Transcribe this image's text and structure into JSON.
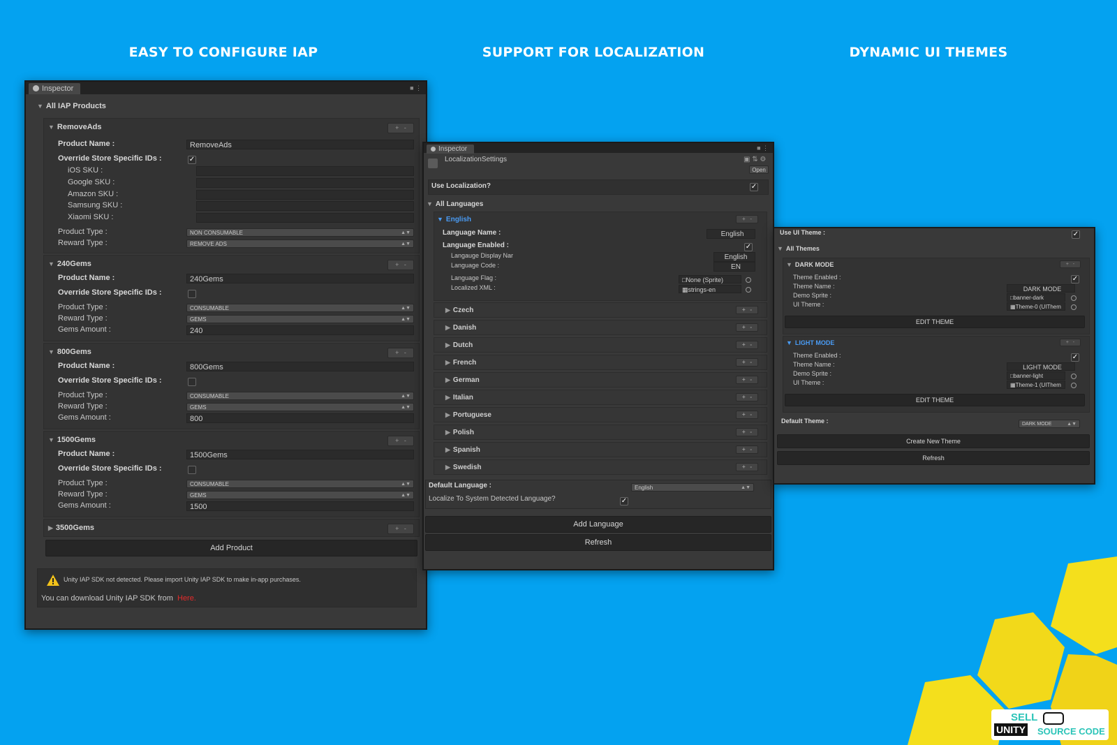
{
  "headings": {
    "iap": "EASY TO CONFIGURE IAP",
    "localization": "SUPPORT FOR LOCALIZATION",
    "themes": "DYNAMIC UI THEMES"
  },
  "iap_panel": {
    "tab": "Inspector",
    "root_label": "All IAP Products",
    "labels": {
      "product_name": "Product Name :",
      "override": "Override Store Specific IDs :",
      "ios": "iOS SKU :",
      "google": "Google SKU :",
      "amazon": "Amazon SKU :",
      "samsung": "Samsung SKU :",
      "xiaomi": "Xiaomi SKU :",
      "product_type": "Product Type :",
      "reward_type": "Reward Type :",
      "gems_amount": "Gems Amount :"
    },
    "products": [
      {
        "title": "RemoveAds",
        "name": "RemoveAds",
        "override": true,
        "product_type": "NON CONSUMABLE",
        "reward_type": "REMOVE ADS"
      },
      {
        "title": "240Gems",
        "name": "240Gems",
        "override": false,
        "product_type": "CONSUMABLE",
        "reward_type": "GEMS",
        "gems_amount": "240"
      },
      {
        "title": "800Gems",
        "name": "800Gems",
        "override": false,
        "product_type": "CONSUMABLE",
        "reward_type": "GEMS",
        "gems_amount": "800"
      },
      {
        "title": "1500Gems",
        "name": "1500Gems",
        "override": false,
        "product_type": "CONSUMABLE",
        "reward_type": "GEMS",
        "gems_amount": "1500"
      },
      {
        "title": "3500Gems"
      }
    ],
    "add_product": "Add Product",
    "warning": "Unity IAP SDK not detected. Please import Unity IAP SDK to make in-app purchases.",
    "download_text": "You can download Unity IAP SDK from",
    "download_link": "Here."
  },
  "loc_panel": {
    "tab": "Inspector",
    "asset": "LocalizationSettings",
    "open": "Open",
    "use_localization": "Use Localization?",
    "all_languages": "All Languages",
    "english": {
      "title": "English",
      "language_name_label": "Language Name :",
      "language_name": "English",
      "enabled_label": "Language Enabled :",
      "display_label": "Langauge Display Nar",
      "display": "English",
      "code_label": "Language Code :",
      "code": "EN",
      "flag_label": "Language Flag :",
      "flag": "None (Sprite)",
      "xml_label": "Localized XML :",
      "xml": "strings-en"
    },
    "languages": [
      "Czech",
      "Danish",
      "Dutch",
      "French",
      "German",
      "Italian",
      "Portuguese",
      "Polish",
      "Spanish",
      "Swedish"
    ],
    "default_language_label": "Default Language :",
    "default_language": "English",
    "localize_system": "Localize To System Detected Language?",
    "add_language": "Add Language",
    "refresh": "Refresh"
  },
  "theme_panel": {
    "use_ui_theme": "Use UI Theme :",
    "all_themes": "All Themes",
    "labels": {
      "enabled": "Theme Enabled :",
      "name": "Theme Name :",
      "sprite": "Demo Sprite :",
      "ui_theme": "UI Theme :"
    },
    "themes": [
      {
        "title": "DARK MODE",
        "name": "DARK MODE",
        "sprite": "banner-dark",
        "ui_theme": "Theme-0 (UIThem",
        "edit": "EDIT THEME"
      },
      {
        "title": "LIGHT MODE",
        "name": "LIGHT MODE",
        "sprite": "banner-light",
        "ui_theme": "Theme-1 (UIThem",
        "edit": "EDIT THEME"
      }
    ],
    "default_theme_label": "Default Theme :",
    "default_theme": "DARK MODE",
    "create_new": "Create New Theme",
    "refresh": "Refresh"
  },
  "logo": {
    "sell": "SELL",
    "unity": "UNITY",
    "source": "SOURCE CODE"
  },
  "colors": {
    "background": "#04a2f0",
    "panel": "#393939",
    "accent_blue": "#4a9cf5",
    "hex_yellow": "#f4df1c",
    "link_red": "#e52a2a"
  }
}
